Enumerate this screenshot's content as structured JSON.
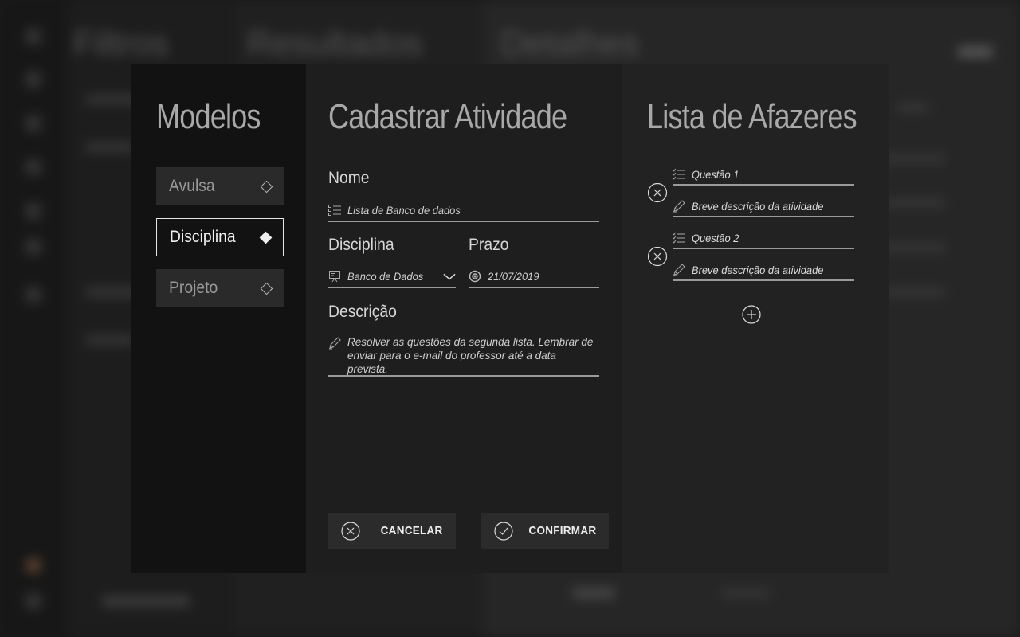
{
  "background": {
    "columns": [
      "Filtros",
      "Resultados",
      "Detalhes"
    ]
  },
  "templates": {
    "title": "Modelos",
    "items": [
      {
        "label": "Avulsa",
        "selected": false
      },
      {
        "label": "Disciplina",
        "selected": true
      },
      {
        "label": "Projeto",
        "selected": false
      }
    ]
  },
  "form": {
    "title": "Cadastrar Atividade",
    "name_label": "Nome",
    "name_value": "Lista de Banco de dados",
    "discipline_label": "Disciplina",
    "discipline_value": "Banco de Dados",
    "deadline_label": "Prazo",
    "deadline_value": "21/07/2019",
    "description_label": "Descrição",
    "description_value": "Resolver as questões da segunda lista. Lembrar de enviar para o e-mail do professor até a data prevista.",
    "cancel_label": "CANCELAR",
    "confirm_label": "CONFIRMAR"
  },
  "todo": {
    "title": "Lista de Afazeres",
    "items": [
      {
        "question": "Questão 1",
        "description_placeholder": "Breve descrição da atividade"
      },
      {
        "question": "Questão 2",
        "description_placeholder": "Breve descrição da atividade"
      }
    ]
  },
  "colors": {
    "accent": "#e6e6e6",
    "panel_dark": "#121212",
    "panel_mid": "#1e1e1e",
    "panel_light": "#222222"
  }
}
